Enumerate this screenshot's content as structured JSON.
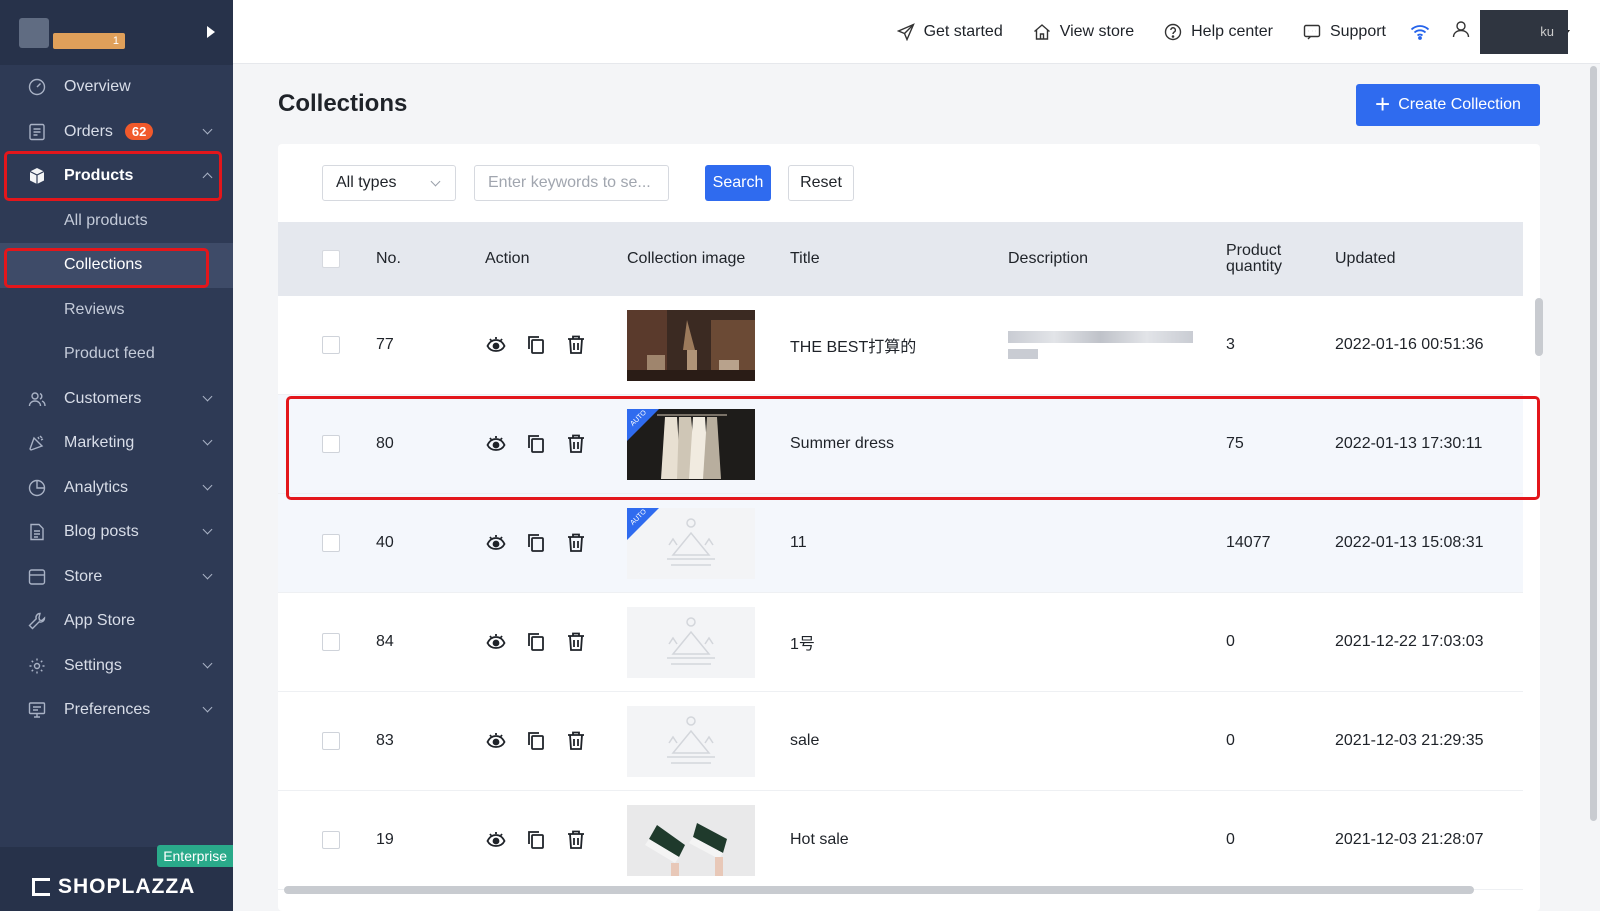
{
  "brand": {
    "badge": "1"
  },
  "sidebar": {
    "items": [
      {
        "label": "Overview",
        "icon": "gauge-icon"
      },
      {
        "label": "Orders",
        "icon": "orders-icon",
        "badge": "62"
      },
      {
        "label": "Products",
        "icon": "box-icon"
      },
      {
        "label": "Customers",
        "icon": "users-icon"
      },
      {
        "label": "Marketing",
        "icon": "megaphone-icon"
      },
      {
        "label": "Analytics",
        "icon": "chart-icon"
      },
      {
        "label": "Blog posts",
        "icon": "blog-icon"
      },
      {
        "label": "Store",
        "icon": "store-icon"
      },
      {
        "label": "App Store",
        "icon": "wrench-icon"
      },
      {
        "label": "Settings",
        "icon": "gear-icon"
      },
      {
        "label": "Preferences",
        "icon": "monitor-icon"
      }
    ],
    "products_sub": [
      "All products",
      "Collections",
      "Reviews",
      "Product feed"
    ],
    "enterprise": "Enterprise",
    "logo": "SHOPLAZZA"
  },
  "topbar": {
    "get_started": "Get started",
    "view_store": "View store",
    "help_center": "Help center",
    "support": "Support",
    "user_short": "ku"
  },
  "page": {
    "title": "Collections",
    "create_button": "Create Collection"
  },
  "filter": {
    "type_value": "All types",
    "keyword_placeholder": "Enter keywords to se...",
    "search": "Search",
    "reset": "Reset"
  },
  "table": {
    "headers": {
      "no": "No.",
      "action": "Action",
      "image": "Collection image",
      "title": "Title",
      "description": "Description",
      "quantity": "Product quantity",
      "updated": "Updated"
    },
    "rows": [
      {
        "no": "77",
        "title": "THE BEST打算的",
        "quantity": "3",
        "updated": "2022-01-16 00:51:36"
      },
      {
        "no": "80",
        "title": "Summer dress",
        "quantity": "75",
        "updated": "2022-01-13 17:30:11"
      },
      {
        "no": "40",
        "title": "11",
        "quantity": "14077",
        "updated": "2022-01-13 15:08:31"
      },
      {
        "no": "84",
        "title": "1号",
        "quantity": "0",
        "updated": "2021-12-22 17:03:03"
      },
      {
        "no": "83",
        "title": "sale",
        "quantity": "0",
        "updated": "2021-12-03 21:29:35"
      },
      {
        "no": "19",
        "title": "Hot sale",
        "quantity": "0",
        "updated": "2021-12-03 21:28:07"
      }
    ],
    "auto_tag": "AUTO"
  },
  "colors": {
    "sidebar_bg": "#2e3a55",
    "accent": "#2f6bef",
    "highlight": "#e3161b",
    "badge": "#f1592b"
  }
}
